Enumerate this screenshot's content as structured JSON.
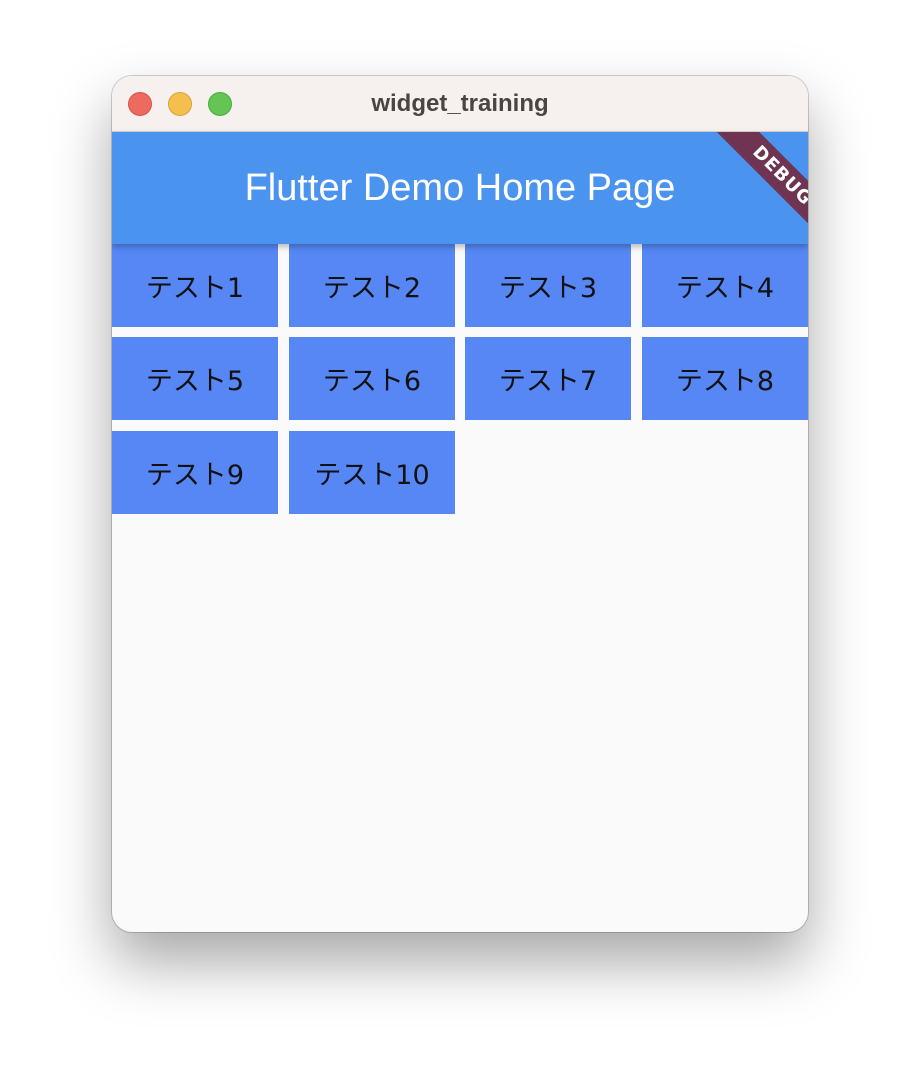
{
  "window": {
    "title": "widget_training"
  },
  "appbar": {
    "title": "Flutter Demo Home Page"
  },
  "debug_banner": {
    "label": "DEBUG"
  },
  "grid": {
    "tiles": [
      {
        "label": "テスト1"
      },
      {
        "label": "テスト2"
      },
      {
        "label": "テスト3"
      },
      {
        "label": "テスト4"
      },
      {
        "label": "テスト5"
      },
      {
        "label": "テスト6"
      },
      {
        "label": "テスト7"
      },
      {
        "label": "テスト8"
      },
      {
        "label": "テスト9"
      },
      {
        "label": "テスト10"
      }
    ]
  },
  "colors": {
    "appbar": "#4a93ee",
    "tile": "#5687f5",
    "debug_banner": "#6e3451",
    "background": "#fafafa"
  }
}
